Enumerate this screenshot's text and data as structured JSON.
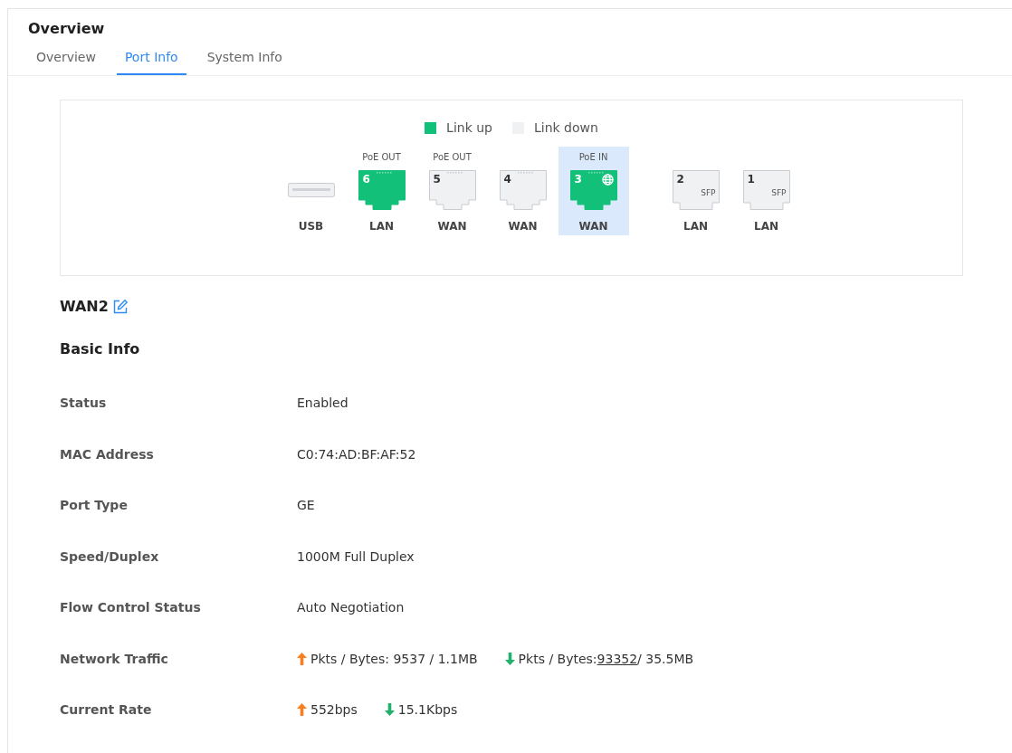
{
  "title": "Overview",
  "tabs": [
    {
      "label": "Overview",
      "selected": false
    },
    {
      "label": "Port Info",
      "selected": true
    },
    {
      "label": "System Info",
      "selected": false
    }
  ],
  "legend": [
    {
      "label": "Link up",
      "color": "#13c07a"
    },
    {
      "label": "Link down",
      "color": "#f0f1f3"
    }
  ],
  "port_groups": [
    [
      {
        "kind": "usb",
        "name": "USB",
        "link_up": false,
        "selected": false
      },
      {
        "kind": "rj45",
        "number": "6",
        "poe": "PoE OUT",
        "name": "LAN",
        "link_up": true,
        "selected": false,
        "internet": false
      },
      {
        "kind": "rj45",
        "number": "5",
        "poe": "PoE OUT",
        "name": "WAN",
        "link_up": false,
        "selected": false,
        "internet": false
      },
      {
        "kind": "rj45",
        "number": "4",
        "name": "WAN",
        "link_up": false,
        "selected": false,
        "internet": false
      },
      {
        "kind": "rj45",
        "number": "3",
        "poe": "PoE IN",
        "name": "WAN",
        "link_up": true,
        "selected": true,
        "internet": true
      }
    ],
    [
      {
        "kind": "sfp",
        "number": "2",
        "tag": "SFP",
        "name": "LAN",
        "link_up": false,
        "selected": false
      },
      {
        "kind": "sfp",
        "number": "1",
        "tag": "SFP",
        "name": "LAN",
        "link_up": false,
        "selected": false
      }
    ]
  ],
  "port_title": "WAN2",
  "section_title": "Basic Info",
  "rows": [
    {
      "kind": "text",
      "label": "Status",
      "value": "Enabled"
    },
    {
      "kind": "text",
      "label": "MAC Address",
      "value": "C0:74:AD:BF:AF:52"
    },
    {
      "kind": "text",
      "label": "Port Type",
      "value": "GE"
    },
    {
      "kind": "text",
      "label": "Speed/Duplex",
      "value": "1000M Full Duplex"
    },
    {
      "kind": "text",
      "label": "Flow Control Status",
      "value": "Auto Negotiation"
    },
    {
      "kind": "traffic",
      "label": "Network Traffic",
      "up": {
        "text": "Pkts / Bytes: 9537 / 1.1MB"
      },
      "down": {
        "prefix": "Pkts / Bytes:",
        "underlined": "93352",
        "suffix": "/ 35.5MB"
      }
    },
    {
      "kind": "traffic",
      "label": "Current Rate",
      "up": {
        "text": "552bps"
      },
      "down": {
        "text": "15.1Kbps"
      }
    }
  ]
}
